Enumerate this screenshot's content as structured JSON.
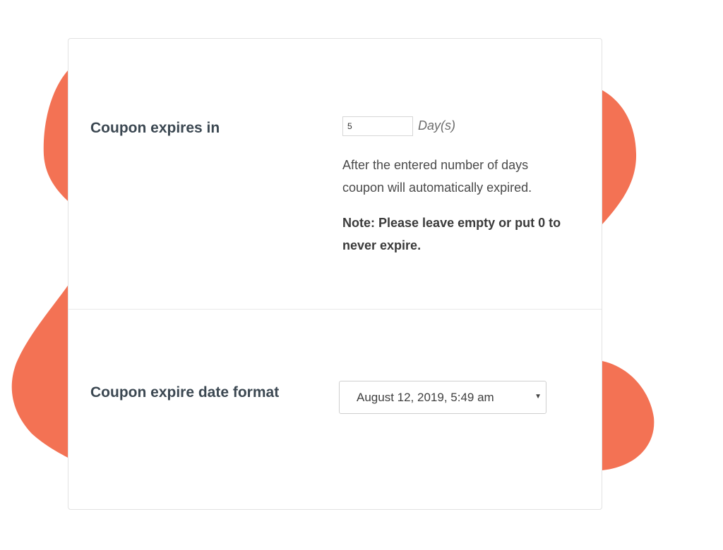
{
  "expiry": {
    "label": "Coupon expires in",
    "days_value": "5",
    "days_suffix": "Day(s)",
    "description": "After the entered number of days coupon will automatically expired.",
    "note": "Note: Please leave empty or put 0 to never expire."
  },
  "date_format": {
    "label": "Coupon expire date format",
    "selected": "August 12, 2019, 5:49 am"
  },
  "colors": {
    "blob": "#f37254",
    "card_border": "#e2e2e2",
    "label_text": "#3c4852"
  }
}
